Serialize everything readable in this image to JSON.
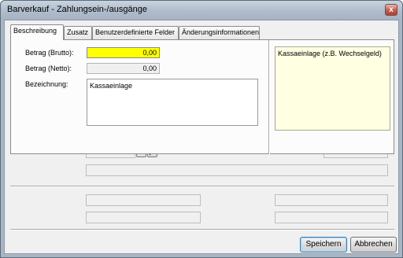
{
  "window": {
    "title": "Barverkauf - Zahlungsein-/ausgänge",
    "close_label": "x"
  },
  "tabs": [
    {
      "label": "Beschreibung"
    },
    {
      "label": "Zusatz"
    },
    {
      "label": "Benutzerdefinierte Felder"
    },
    {
      "label": "Änderungsinformationen"
    }
  ],
  "form": {
    "betrag_brutto_label": "Betrag (Brutto):",
    "betrag_brutto_value": "0,00",
    "betrag_netto_label": "Betrag (Netto):",
    "betrag_netto_value": "0,00",
    "bezeichnung_label": "Bezeichnung:",
    "bezeichnung_value": "Kassaeinlage",
    "note_text": "Kassaeinlage (z.B. Wechselgeld)"
  },
  "lookup": {
    "browse_label": "...",
    "search_icon": "search-icon"
  },
  "buttons": {
    "save": "Speichern",
    "cancel": "Abbrechen"
  }
}
